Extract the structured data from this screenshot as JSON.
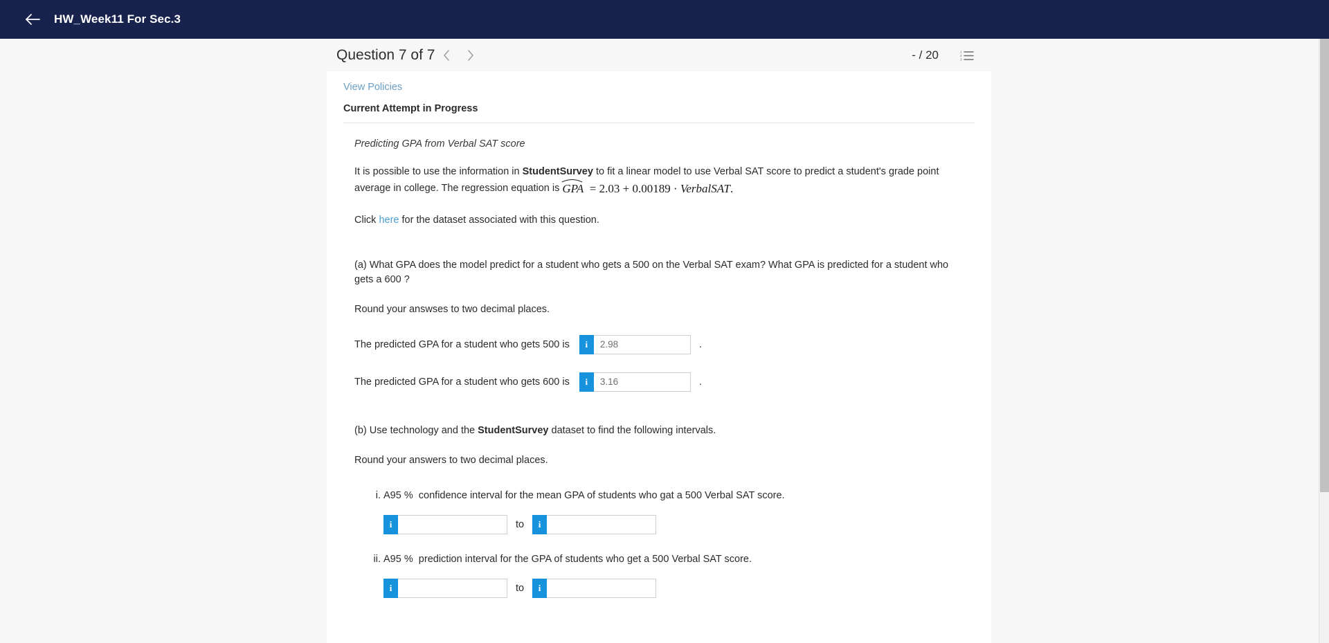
{
  "appbar": {
    "back_icon": "back-arrow-icon",
    "title": "HW_Week11 For Sec.3"
  },
  "question_nav": {
    "title": "Question 7 of 7",
    "prev_icon": "chevron-left-icon",
    "next_icon": "chevron-right-icon",
    "score": "- / 20",
    "list_icon": "numbered-list-icon"
  },
  "meta": {
    "view_policies": "View Policies",
    "attempt_status": "Current Attempt in Progress"
  },
  "question": {
    "prompt_title": "Predicting GPA from Verbal SAT score",
    "intro_part1": "It is possible to use the information in ",
    "intro_dataset": "StudentSurvey",
    "intro_part2": " to fit a linear model to use Verbal SAT score to predict a student's grade point average in college. The regression equation is ",
    "equation": {
      "lhs": "GPA",
      "equals": "=",
      "intercept": "2.03",
      "plus": "+",
      "slope": "0.00189",
      "dot": "·",
      "variable": "VerbalSAT",
      "period": "."
    },
    "dataset_line_before": "Click ",
    "dataset_link": "here",
    "dataset_line_after": " for the dataset associated with this question.",
    "part_a": {
      "text": "(a) What GPA does the model predict for a student who gets a 500 on the Verbal SAT exam? What GPA is predicted for a student who gets a 600 ?",
      "rounding": "Round your answses to two decimal places.",
      "answers": [
        {
          "label": "The predicted GPA for a student who gets 500 is",
          "value": "2.98",
          "info_icon": "info-icon",
          "trailing": "."
        },
        {
          "label": "The predicted GPA for a student who gets 600 is",
          "value": "3.16",
          "info_icon": "info-icon",
          "trailing": "."
        }
      ]
    },
    "part_b": {
      "text_before": "(b) Use technology and the ",
      "dataset": "StudentSurvey",
      "text_after": " dataset to find the following intervals.",
      "rounding": "Round your answers to two decimal places.",
      "items": [
        {
          "text_a": "A",
          "percent": "95 %",
          "text_b": "confidence interval for the mean GPA of students who gat a 500 Verbal SAT score.",
          "lower_value": "",
          "upper_value": "",
          "separator": "to",
          "info_icon": "info-icon"
        },
        {
          "text_a": "A",
          "percent": "95 %",
          "text_b": "prediction interval for the GPA of students who get a 500 Verbal SAT score.",
          "lower_value": "",
          "upper_value": "",
          "separator": "to",
          "info_icon": "info-icon"
        }
      ]
    }
  },
  "colors": {
    "appbar_bg": "#17224d",
    "accent_blue": "#1793dd",
    "link_blue": "#4a9fd4",
    "page_bg": "#f7f7f8"
  }
}
